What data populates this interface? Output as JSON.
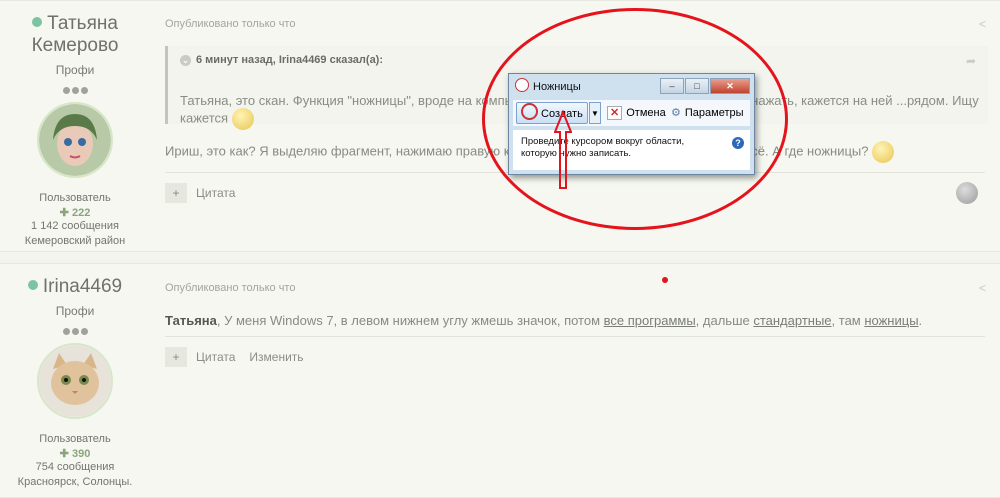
{
  "posts": [
    {
      "author": "Татьяна Кемерово",
      "rank": "Профи",
      "role": "Пользователь",
      "reputation": "222",
      "message_count": "1 142 сообщения",
      "location": "Кемеровский район",
      "posted": "Опубликовано только что",
      "quote_header": "6 минут назад, Irina4469 сказал(а):",
      "quote_text": "Татьяна, это скан. Функция \"ножницы\", вроде на компьютере есть, и кнопка слева внизу, если нажать, кажется на ней ...рядом. Ищу кажется",
      "body": "Ириш, это как? Я выделяю фрагмент, нажимаю правую кнопку мыши, там есть сохранить как и всё.  А где ножницы?",
      "actions": [
        "Цитата"
      ]
    },
    {
      "author": "Irina4469",
      "rank": "Профи",
      "role": "Пользователь",
      "reputation": "390",
      "message_count": "754 сообщения",
      "location": "Красноярск, Солонцы.",
      "posted": "Опубликовано только что",
      "body_bold": "Татьяна",
      "body_a": ", У меня Windows 7, в левом нижнем углу жмешь значок, потом ",
      "body_link1": "все программы",
      "body_b": ", дальше ",
      "body_link2": "стандартные",
      "body_c": ", там ",
      "body_link3": "ножницы",
      "body_d": ".",
      "actions": [
        "Цитата",
        "Изменить"
      ]
    }
  ],
  "snipping_tool": {
    "title": "Ножницы",
    "create_label": "Создать",
    "cancel_label": "Отмена",
    "options_label": "Параметры",
    "hint": "Проведите курсором вокруг области, которую нужно записать."
  },
  "icons": {
    "plus": "+",
    "share": "share-icon",
    "reputation": "reputation-icon"
  },
  "colors": {
    "annotation": "#e4131c",
    "online": "#7cc4a1",
    "background": "#f6f7f1"
  }
}
